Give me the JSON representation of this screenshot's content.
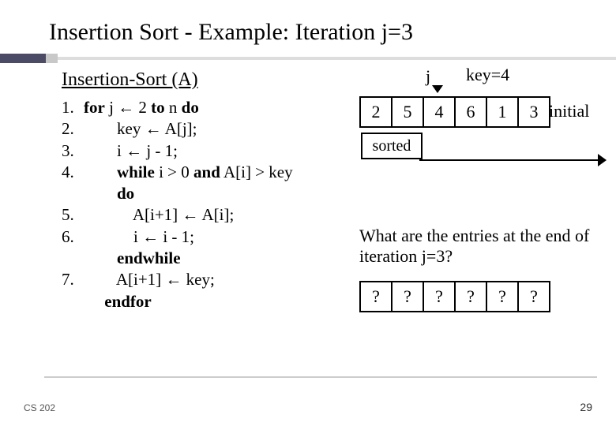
{
  "title": "Insertion Sort - Example: Iteration j=3",
  "algo_title": "Insertion-Sort (A)",
  "algo": {
    "l1_num": "1.",
    "l1_a": "for",
    "l1_b": " j ← 2 ",
    "l1_c": "to",
    "l1_d": " n ",
    "l1_e": "do",
    "l2_num": "2.",
    "l2": "key ← A[j];",
    "l3_num": "3.",
    "l3": "i ← j - 1;",
    "l4_num": "4.",
    "l4_a": "while",
    "l4_b": " i > 0 ",
    "l4_c": "and",
    "l4_d": " A[i] > key",
    "l4e": "do",
    "l5_num": "5.",
    "l5": "A[i+1] ← A[i];",
    "l6_num": "6.",
    "l6": "i ← i - 1;",
    "l6e": "endwhile",
    "l7_num": "7.",
    "l7": "A[i+1] ← key;",
    "l7e": "endfor"
  },
  "right": {
    "j_label": "j",
    "key_label": "key=4",
    "array1": [
      "2",
      "5",
      "4",
      "6",
      "1",
      "3"
    ],
    "initial": "initial",
    "sorted": "sorted",
    "question": "What are the entries at the end of iteration j=3?",
    "array2": [
      "?",
      "?",
      "?",
      "?",
      "?",
      "?"
    ]
  },
  "footer": {
    "left": "CS 202",
    "page": "29"
  }
}
